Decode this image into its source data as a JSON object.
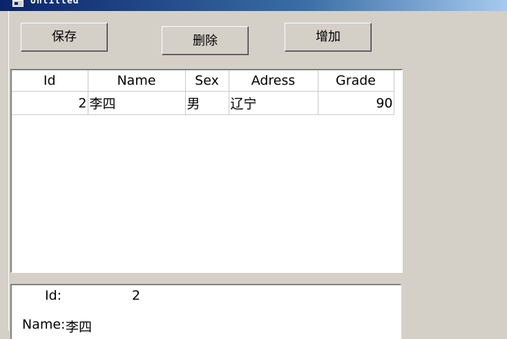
{
  "window": {
    "title": "Untitled"
  },
  "toolbar": {
    "save_label": "保存",
    "delete_label": "删除",
    "add_label": "增加"
  },
  "table": {
    "columns": [
      "Id",
      "Name",
      "Sex",
      "Adress",
      "Grade"
    ],
    "rows": [
      {
        "id": "2",
        "name": "李四",
        "sex": "男",
        "adress": "辽宁",
        "grade": "90"
      }
    ]
  },
  "detail": {
    "id_label": "Id:",
    "id_value": "2",
    "name_label": "Name:",
    "name_value": "李四"
  }
}
